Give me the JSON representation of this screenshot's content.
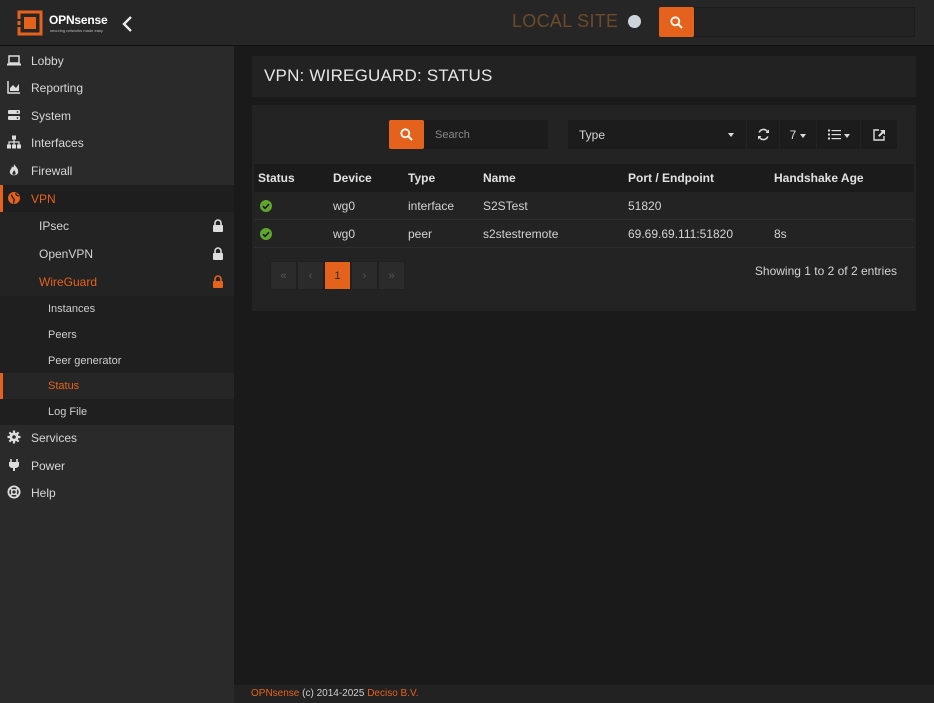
{
  "brand": {
    "name": "OPNsense",
    "tagline": "securing networks made easy",
    "accent_color": "#e5621c"
  },
  "topbar": {
    "site_name": "LOCAL SITE",
    "search_icon": "search-icon",
    "collapse_icon": "chevron-left-icon"
  },
  "sidebar": {
    "items": [
      {
        "label": "Lobby",
        "icon": "laptop-icon"
      },
      {
        "label": "Reporting",
        "icon": "area-chart-icon"
      },
      {
        "label": "System",
        "icon": "server-icon"
      },
      {
        "label": "Interfaces",
        "icon": "sitemap-icon"
      },
      {
        "label": "Firewall",
        "icon": "fire-icon"
      },
      {
        "label": "VPN",
        "icon": "globe-icon"
      },
      {
        "label": "Services",
        "icon": "cog-icon"
      },
      {
        "label": "Power",
        "icon": "plug-icon"
      },
      {
        "label": "Help",
        "icon": "life-ring-icon"
      }
    ],
    "vpn_sub": [
      {
        "label": "IPsec",
        "icon": "lock-icon"
      },
      {
        "label": "OpenVPN",
        "icon": "lock-icon"
      },
      {
        "label": "WireGuard",
        "icon": "lock-icon"
      }
    ],
    "wireguard_sub": [
      {
        "label": "Instances"
      },
      {
        "label": "Peers"
      },
      {
        "label": "Peer generator"
      },
      {
        "label": "Status"
      },
      {
        "label": "Log File"
      }
    ]
  },
  "page": {
    "title": "VPN: WIREGUARD: STATUS"
  },
  "grid": {
    "search_placeholder": "Search",
    "type_select": "Type",
    "page_size": "7",
    "columns": [
      "Status",
      "Device",
      "Type",
      "Name",
      "Port / Endpoint",
      "Handshake Age"
    ],
    "rows": [
      {
        "status": "ok",
        "device": "wg0",
        "type": "interface",
        "name": "S2STest",
        "endpoint": "51820",
        "handshake": ""
      },
      {
        "status": "ok",
        "device": "wg0",
        "type": "peer",
        "name": "s2stestremote",
        "endpoint": "69.69.69.111:51820",
        "handshake": "8s"
      }
    ],
    "pager": {
      "first": "«",
      "prev": "‹",
      "current": "1",
      "next": "›",
      "last": "»"
    },
    "showing": "Showing 1 to 2 of 2 entries"
  },
  "footer": {
    "brand": "OPNsense",
    "copyright": "(c) 2014-2025",
    "company": "Deciso B.V."
  }
}
